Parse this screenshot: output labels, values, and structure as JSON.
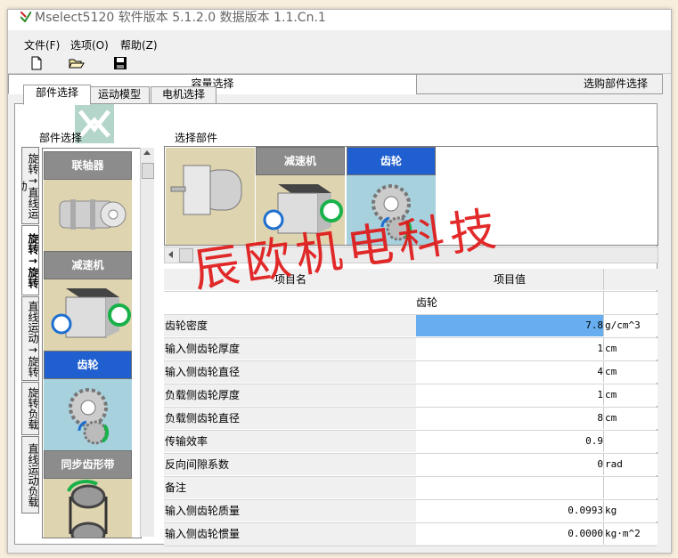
{
  "window": {
    "title": "Mselect5120  软件版本  5.1.2.0    数据版本  1.1.Cn.1"
  },
  "menu": [
    {
      "label": "文件(F)"
    },
    {
      "label": "选项(O)"
    },
    {
      "label": "帮助(Z)"
    }
  ],
  "toolbar": [
    {
      "icon": "new-file-icon"
    },
    {
      "icon": "open-folder-icon"
    },
    {
      "icon": "save-icon"
    }
  ],
  "top_tabs": [
    {
      "label": "容量选择",
      "active": true
    },
    {
      "label": "选购部件选择",
      "active": false
    }
  ],
  "sub_tabs": [
    {
      "label": "部件选择",
      "active": true
    },
    {
      "label": "运动模型",
      "active": false
    },
    {
      "label": "电机选择",
      "active": false
    }
  ],
  "left_panel": {
    "title": "部件选择",
    "vertical_tabs": [
      {
        "label": "旋转→直线运动"
      },
      {
        "label": "旋转→旋转",
        "active": true
      },
      {
        "label": "直线运动→旋转"
      },
      {
        "label": "旋转负载"
      },
      {
        "label": "直线运动负载"
      }
    ],
    "components": [
      {
        "label": "联轴器",
        "selected": false
      },
      {
        "label": "减速机",
        "selected": false
      },
      {
        "label": "齿轮",
        "selected": true
      },
      {
        "label": "同步齿形带",
        "selected": false
      }
    ]
  },
  "right_panel": {
    "title": "选择部件",
    "selected_parts": [
      {
        "label": "",
        "type": "motor"
      },
      {
        "label": "减速机",
        "type": "reducer"
      },
      {
        "label": "齿轮",
        "type": "gear",
        "selected": true
      }
    ]
  },
  "table": {
    "headers": [
      "项目名",
      "项目值"
    ],
    "group_row": "齿轮",
    "rows": [
      {
        "name": "齿轮密度",
        "value": "7.8",
        "unit": "g/cm^3",
        "highlight": true
      },
      {
        "name": "输入侧齿轮厚度",
        "value": "1",
        "unit": "cm"
      },
      {
        "name": "输入侧齿轮直径",
        "value": "4",
        "unit": "cm"
      },
      {
        "name": "负载侧齿轮厚度",
        "value": "1",
        "unit": "cm"
      },
      {
        "name": "负载侧齿轮直径",
        "value": "8",
        "unit": "cm"
      },
      {
        "name": "传输效率",
        "value": "0.9",
        "unit": ""
      },
      {
        "name": "反向间隙系数",
        "value": "0",
        "unit": "rad"
      },
      {
        "name": "备注",
        "value": "",
        "unit": ""
      },
      {
        "name": "输入侧齿轮质量",
        "value": "0.0993",
        "unit": "kg"
      },
      {
        "name": "输入侧齿轮惯量",
        "value": "0.0000",
        "unit": "kg·m^2"
      }
    ]
  },
  "watermark": "辰欧机电科技",
  "colors": {
    "selected_header": "#1f5fcf",
    "component_bg": "#dfd4b0",
    "selected_bg": "#a8d1de",
    "highlight_cell": "#66aef0",
    "watermark": "#e01818"
  }
}
